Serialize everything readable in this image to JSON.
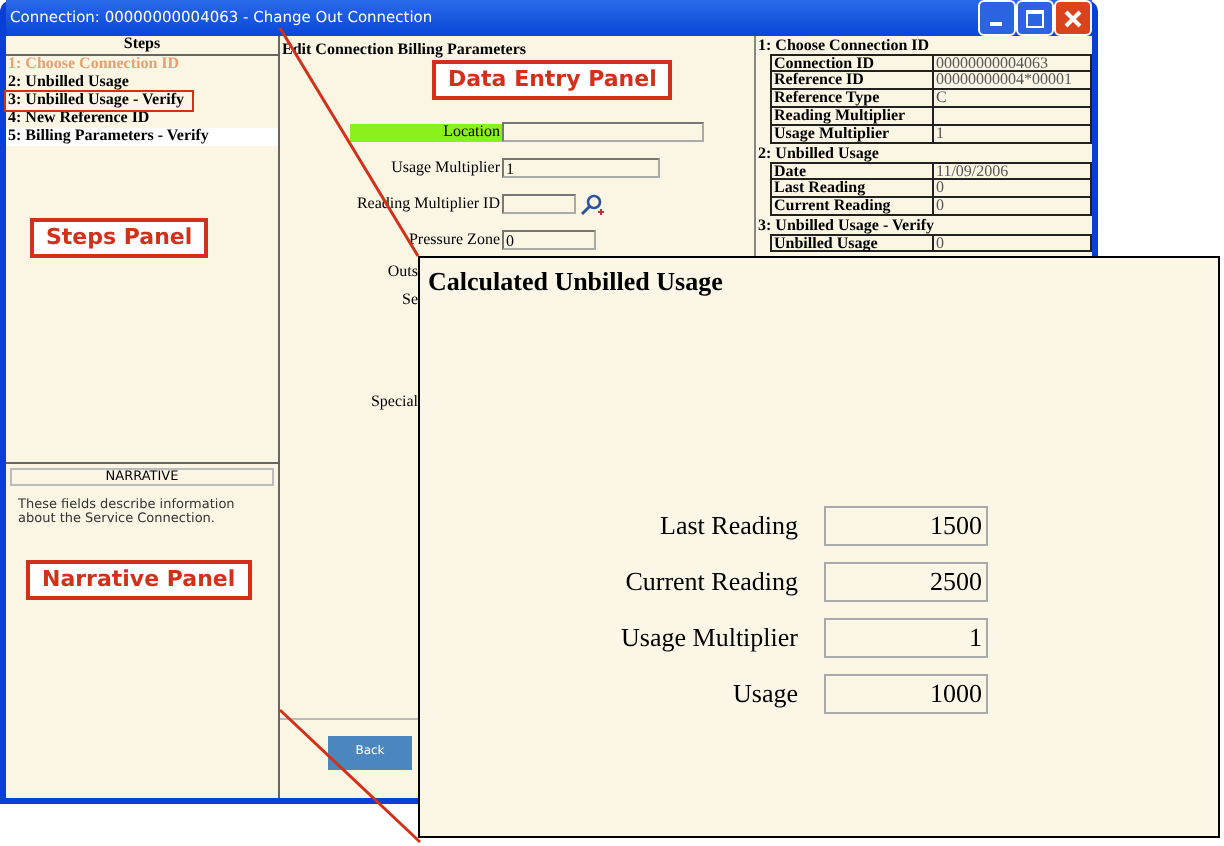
{
  "window": {
    "title": "Connection: 00000000004063 - Change Out Connection"
  },
  "steps_panel": {
    "header": "Steps",
    "annotation": "Steps Panel",
    "items": [
      {
        "label": "1: Choose Connection ID",
        "visited": true,
        "selected": false,
        "outlined": false
      },
      {
        "label": "2: Unbilled Usage",
        "visited": false,
        "selected": false,
        "outlined": false
      },
      {
        "label": "3: Unbilled Usage - Verify",
        "visited": false,
        "selected": false,
        "outlined": true
      },
      {
        "label": "4: New Reference ID",
        "visited": false,
        "selected": false,
        "outlined": false
      },
      {
        "label": "5: Billing Parameters - Verify",
        "visited": false,
        "selected": true,
        "outlined": false
      }
    ]
  },
  "narrative_panel": {
    "header": "NARRATIVE",
    "text": "These fields describe information about the Service Connection.",
    "annotation": "Narrative Panel"
  },
  "data_entry": {
    "title": "Edit Connection Billing Parameters",
    "annotation": "Data Entry Panel",
    "fields": [
      {
        "label": "Location",
        "highlighted": true,
        "lookup": false
      },
      {
        "label": "Usage Multiplier",
        "value": "1",
        "highlighted": false,
        "lookup": false
      },
      {
        "label": "Reading Multiplier ID",
        "highlighted": false,
        "lookup": true
      },
      {
        "label": "Pressure Zone",
        "value": "0",
        "highlighted": false,
        "lookup": false
      }
    ],
    "partial_labels": [
      "Outs",
      "Se",
      "Special"
    ],
    "buttons": [
      "Back"
    ]
  },
  "summary": {
    "sections": [
      {
        "title": "1: Choose Connection ID",
        "rows": [
          {
            "label": "Connection ID",
            "value": "00000000004063"
          },
          {
            "label": "Reference ID",
            "value": "00000000004*00001"
          },
          {
            "label": "Reference Type",
            "value": "C"
          },
          {
            "label": "Reading Multiplier"
          },
          {
            "label": "Usage Multiplier",
            "value": "1"
          }
        ]
      },
      {
        "title": "2: Unbilled Usage",
        "rows": [
          {
            "label": "Date",
            "value": "11/09/2006"
          },
          {
            "label": "Last Reading",
            "value": "0"
          },
          {
            "label": "Current Reading",
            "value": "0"
          }
        ]
      },
      {
        "title": "3: Unbilled Usage - Verify",
        "rows": [
          {
            "label": "Unbilled Usage",
            "value": "0"
          }
        ]
      }
    ]
  },
  "callout": {
    "title": "Calculated Unbilled Usage",
    "fields": [
      {
        "label": "Last Reading",
        "value": "1500"
      },
      {
        "label": "Current Reading",
        "value": "2500"
      },
      {
        "label": "Usage Multiplier",
        "value": "1"
      },
      {
        "label": "Usage",
        "value": "1000"
      }
    ]
  }
}
